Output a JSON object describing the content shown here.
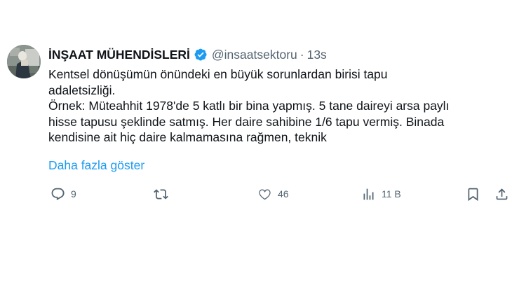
{
  "tweet": {
    "author_name": "İNŞAAT MÜHENDİSLERİ",
    "handle": "@insaatsektoru",
    "separator": "·",
    "time": "13s",
    "text_lines": [
      "Kentsel dönüşümün önündeki en büyük sorunlardan birisi tapu",
      "adaletsizliği.",
      "Örnek: Müteahhit 1978'de 5 katlı bir bina yapmış. 5 tane daireyi arsa paylı",
      "hisse tapusu şeklinde satmış. Her daire sahibine 1/6 tapu vermiş. Binada",
      "kendisine ait hiç daire kalmamasına rağmen, teknik"
    ],
    "show_more": "Daha fazla göster"
  },
  "actions": {
    "reply_count": "9",
    "retweet_count": "",
    "like_count": "46",
    "views_count": "11 B"
  },
  "icons": [
    "verified-badge-icon",
    "reply-icon",
    "retweet-icon",
    "like-icon",
    "views-icon",
    "bookmark-icon",
    "share-icon"
  ],
  "colors": {
    "text": "#0f1419",
    "secondary": "#536471",
    "link": "#1d9bf0",
    "verified": "#1d9bf0"
  }
}
